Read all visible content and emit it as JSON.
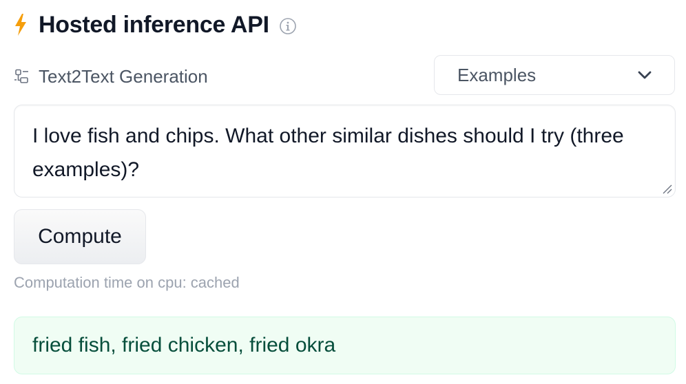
{
  "header": {
    "title": "Hosted inference API",
    "icon": "bolt-icon",
    "info_icon": "info-icon",
    "accent_color": "#f59e0b"
  },
  "task": {
    "icon": "task-icon",
    "label": "Text2Text Generation"
  },
  "examples_select": {
    "label": "Examples",
    "icon": "chevron-down-icon"
  },
  "input": {
    "value": "I love fish and chips. What other similar dishes should I try (three examples)?"
  },
  "compute_button": {
    "label": "Compute"
  },
  "status": {
    "computation_time": "Computation time on cpu: cached"
  },
  "output": {
    "text": "fried fish, fried chicken, fried okra",
    "background_color": "#f0fdf4",
    "text_color": "#064e3b"
  }
}
